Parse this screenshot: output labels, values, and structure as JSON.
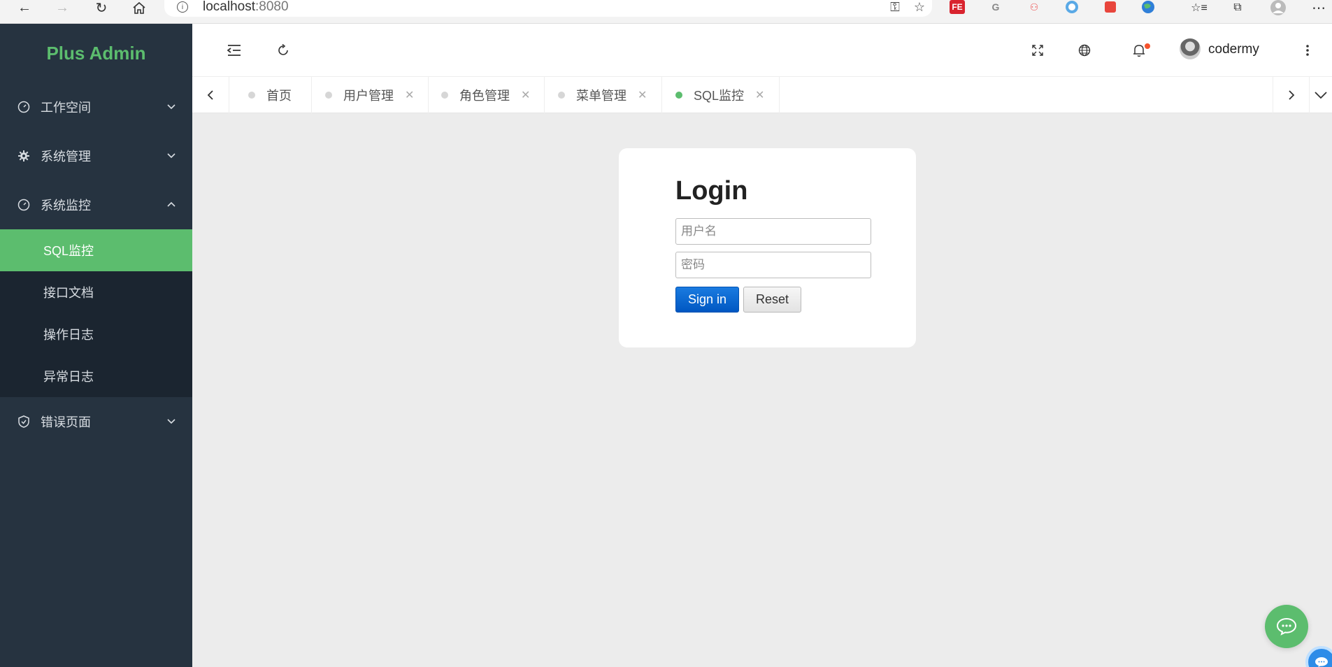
{
  "browser": {
    "url_host": "localhost",
    "url_port": ":8080",
    "extensions": [
      "FE",
      "G"
    ]
  },
  "sidebar": {
    "logo": "Plus Admin",
    "menus": [
      {
        "label": "工作空间",
        "icon": "dashboard-icon",
        "expanded": false
      },
      {
        "label": "系统管理",
        "icon": "gear-icon",
        "expanded": false
      },
      {
        "label": "系统监控",
        "icon": "dashboard-icon",
        "expanded": true,
        "children": [
          {
            "label": "SQL监控",
            "active": true
          },
          {
            "label": "接口文档",
            "active": false
          },
          {
            "label": "操作日志",
            "active": false
          },
          {
            "label": "异常日志",
            "active": false
          }
        ]
      },
      {
        "label": "错误页面",
        "icon": "shield-icon",
        "expanded": false
      }
    ]
  },
  "header": {
    "username": "codermy"
  },
  "tabs": [
    {
      "label": "首页",
      "closable": false,
      "active": false
    },
    {
      "label": "用户管理",
      "closable": true,
      "active": false
    },
    {
      "label": "角色管理",
      "closable": true,
      "active": false
    },
    {
      "label": "菜单管理",
      "closable": true,
      "active": false
    },
    {
      "label": "SQL监控",
      "closable": true,
      "active": true
    }
  ],
  "login": {
    "title": "Login",
    "username_placeholder": "用户名",
    "username_value": "",
    "password_placeholder": "密码",
    "password_value": "",
    "signin_label": "Sign in",
    "reset_label": "Reset"
  },
  "colors": {
    "accent": "#5cbd6e",
    "sidebar_bg": "#263340",
    "submenu_bg": "#1b2530",
    "primary_button": "#0066cc",
    "badge": "#f5532d"
  }
}
